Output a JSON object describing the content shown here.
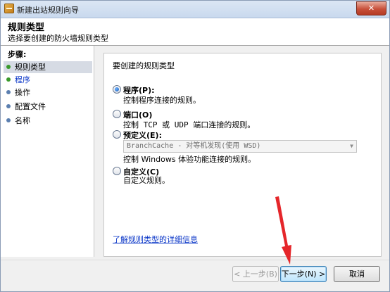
{
  "window": {
    "title": "新建出站规则向导",
    "close_symbol": "✕"
  },
  "header": {
    "title": "规则类型",
    "subtitle": "选择要创建的防火墙规则类型"
  },
  "steps": {
    "heading": "步骤:",
    "items": [
      {
        "label": "规则类型",
        "state": "active"
      },
      {
        "label": "程序",
        "state": "link"
      },
      {
        "label": "操作",
        "state": "normal"
      },
      {
        "label": "配置文件",
        "state": "normal"
      },
      {
        "label": "名称",
        "state": "normal"
      }
    ]
  },
  "content": {
    "prompt": "要创建的规则类型",
    "options": [
      {
        "label": "程序(P):",
        "description": "控制程序连接的规则。",
        "selected": true
      },
      {
        "label": "端口(O)",
        "description": "控制 TCP 或 UDP 端口连接的规则。",
        "selected": false
      },
      {
        "label": "预定义(E):",
        "description": "控制 Windows 体验功能连接的规则。",
        "selected": false,
        "dropdown_value": "BranchCache - 对等机发现(使用 WSD)"
      },
      {
        "label": "自定义(C)",
        "description": "自定义规则。",
        "selected": false
      }
    ],
    "learn_link": "了解规则类型的详细信息"
  },
  "footer": {
    "back_label": "< 上一步(B)",
    "next_label": "下一步(N) >",
    "cancel_label": "取消"
  },
  "colors": {
    "accent_link": "#0a36c8",
    "step_bullet_done": "#3a9a2c",
    "step_bullet_pending": "#5b7fb0",
    "annotation": "#e5262a"
  }
}
